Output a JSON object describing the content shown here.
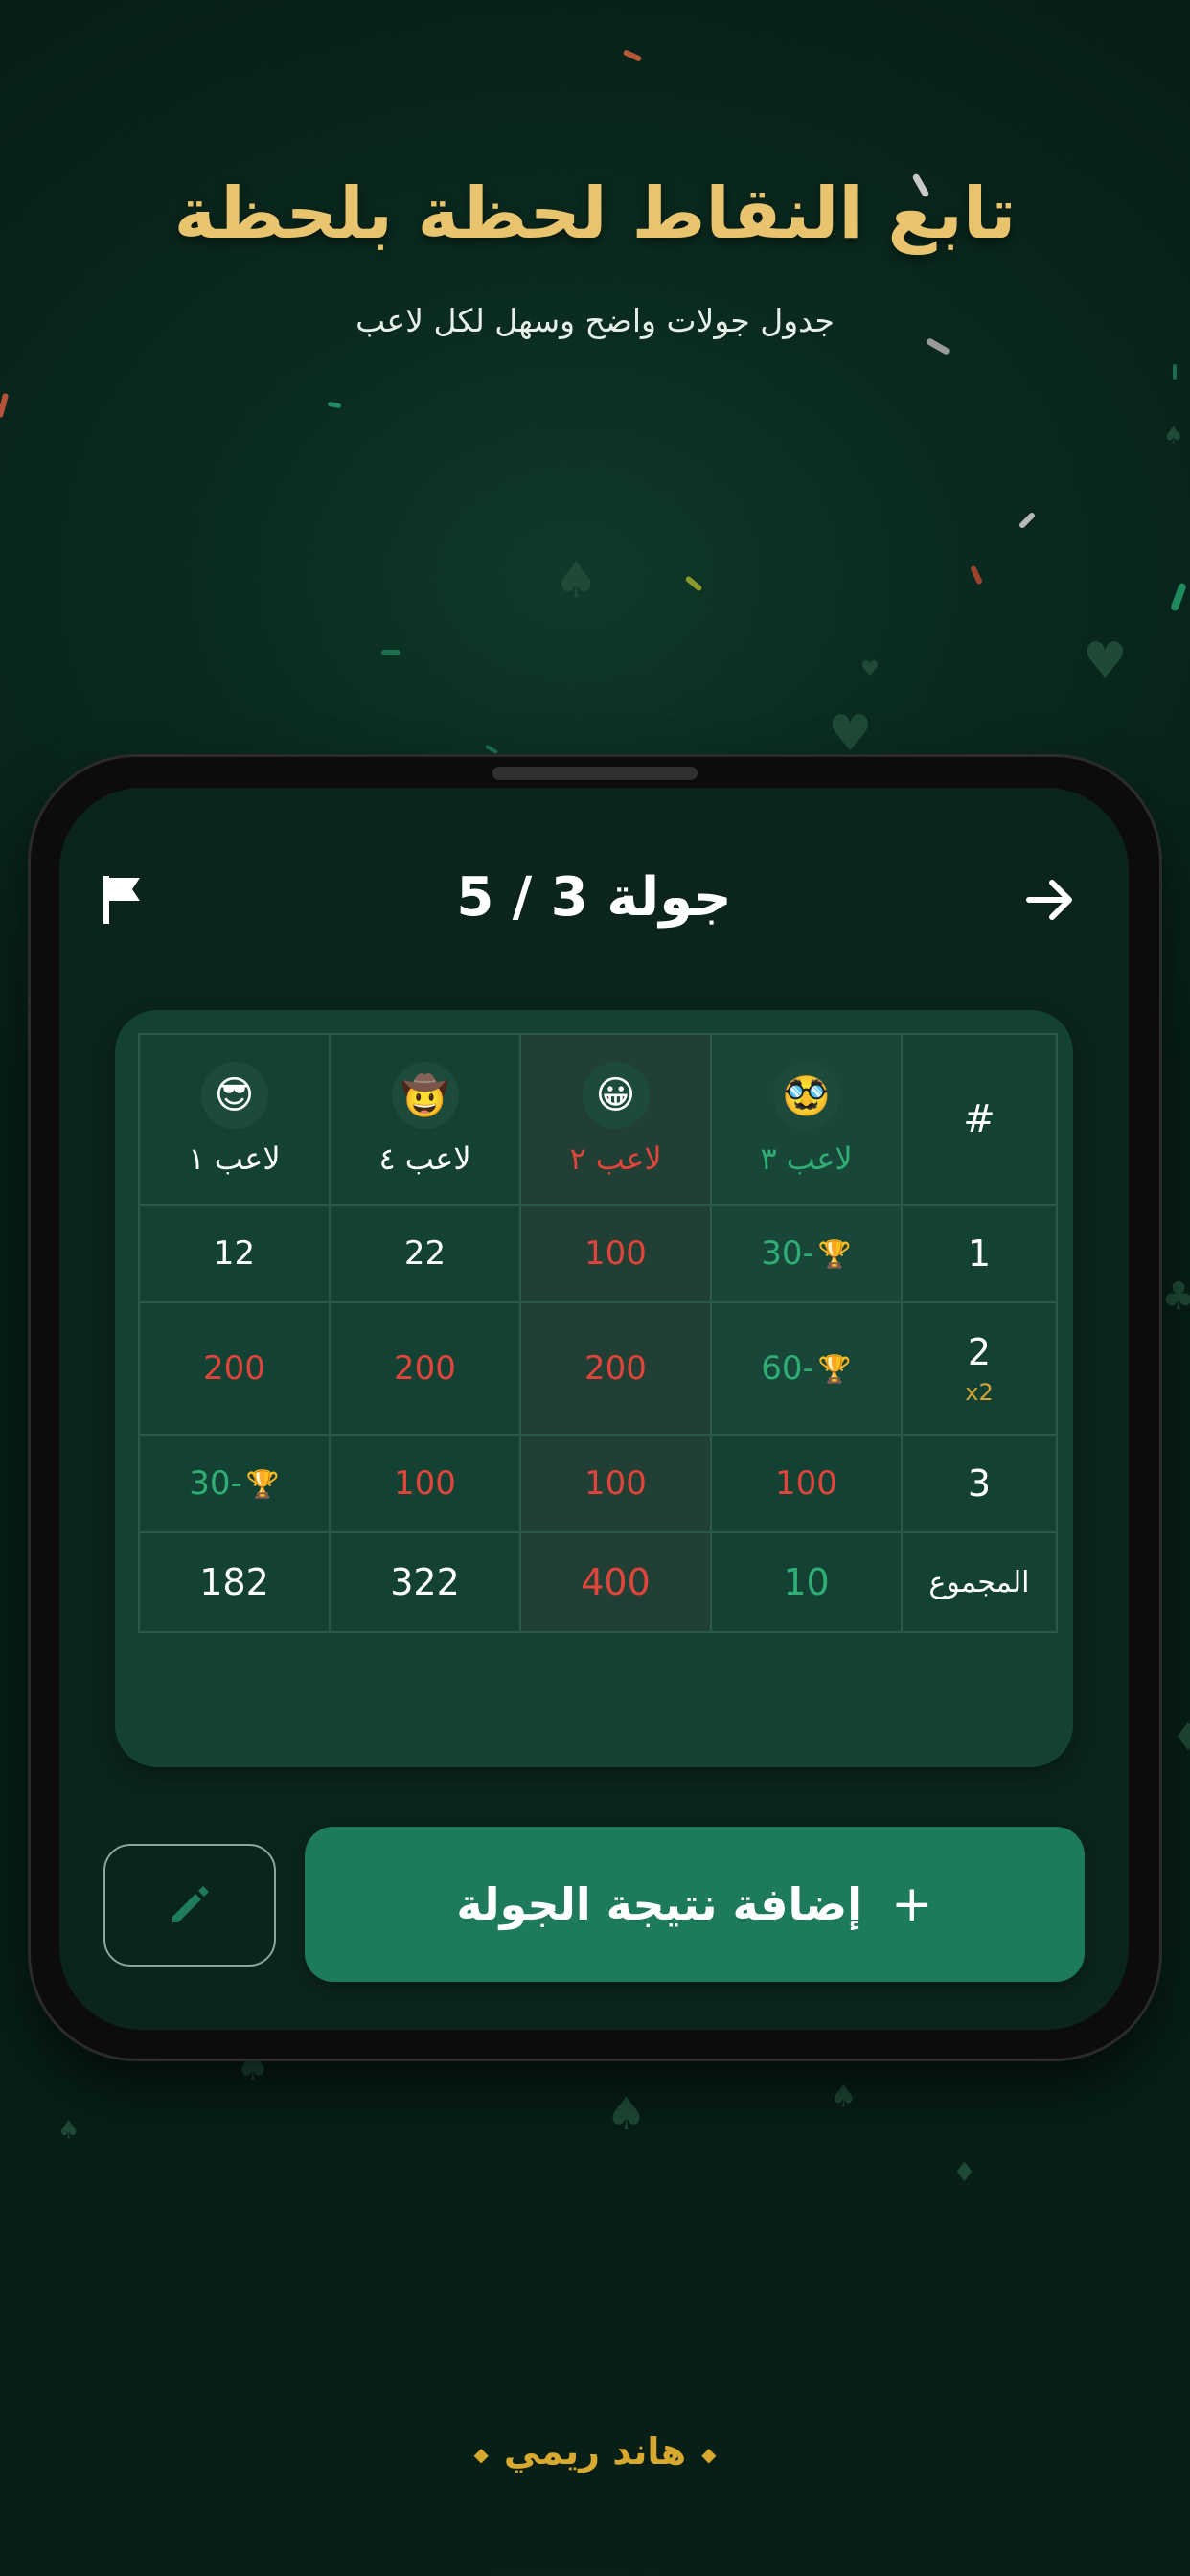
{
  "hero": {
    "title": "تابع النقاط لحظة بلحظة",
    "subtitle": "جدول جولات واضح وسهل لكل لاعب"
  },
  "topbar": {
    "round_label": "جولة  3 / 5",
    "flag_icon": "flag-icon",
    "back_icon": "arrow-right-icon"
  },
  "table": {
    "players": [
      {
        "emoji": "😎",
        "name": "لاعب ١",
        "color": "white"
      },
      {
        "emoji": "🤠",
        "name": "لاعب ٤",
        "color": "white"
      },
      {
        "emoji": "😀",
        "name": "لاعب ٢",
        "color": "red"
      },
      {
        "emoji": "🥸",
        "name": "لاعب ٣",
        "color": "green"
      }
    ],
    "hash": "#",
    "rounds": [
      {
        "num": "1",
        "mult": "",
        "scores": [
          "12",
          "22",
          "100",
          "30-"
        ]
      },
      {
        "num": "2",
        "mult": "x2",
        "scores": [
          "200",
          "200",
          "200",
          "60-"
        ]
      },
      {
        "num": "3",
        "mult": "",
        "scores": [
          "30-",
          "100",
          "100",
          "100"
        ]
      }
    ],
    "total_label": "المجموع",
    "totals": [
      "182",
      "322",
      "400",
      "10"
    ],
    "trophy_icon": "🏆"
  },
  "actions": {
    "add_label": "إضافة نتيجة الجولة",
    "plus": "+",
    "edit_icon": "pencil-icon"
  },
  "footer": {
    "brand": "هاند ريمي",
    "dot": "◆"
  },
  "colors": {
    "gold": "#e8c46f",
    "accent_green": "#1e7a5d",
    "red": "#e0443a",
    "green": "#2fae74"
  }
}
